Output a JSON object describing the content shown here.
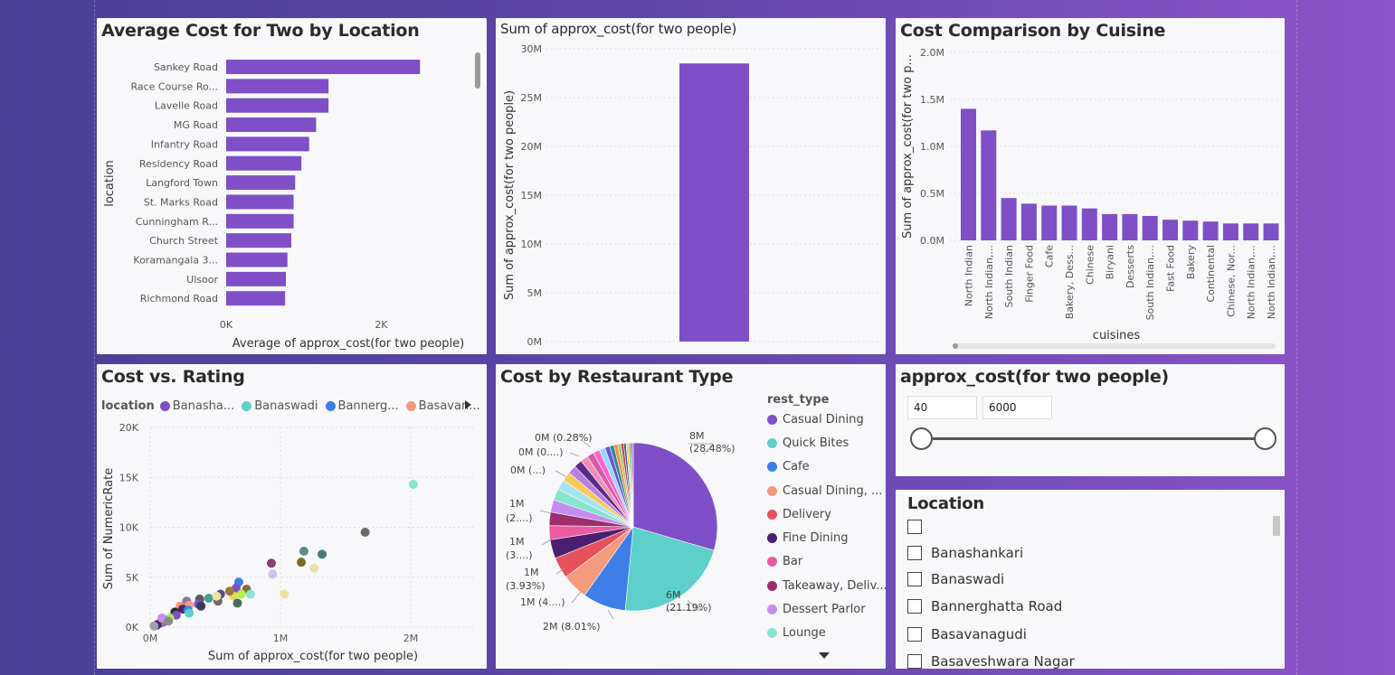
{
  "colors": {
    "bar": "#7e4fc6",
    "panel": "#f8f8fb"
  },
  "location_chart": {
    "title": "Average Cost for Two by Location",
    "xlabel": "Average of approx_cost(for two people)",
    "ylabel": "location",
    "x_ticks": [
      "0K",
      "2K"
    ]
  },
  "sum_chart": {
    "title": "Sum of approx_cost(for two people)",
    "ylabel": "Sum of approx_cost(for two people)",
    "y_ticks": [
      "0M",
      "5M",
      "10M",
      "15M",
      "20M",
      "25M",
      "30M"
    ]
  },
  "cuisine_chart": {
    "title": "Cost Comparison by Cuisine",
    "ylabel": "Sum of approx_cost(for two p...",
    "xlabel": "cuisines",
    "y_ticks": [
      "0.0M",
      "0.5M",
      "1.0M",
      "1.5M",
      "2.0M"
    ]
  },
  "scatter_chart": {
    "title": "Cost vs. Rating",
    "legend_title": "location",
    "legend": [
      {
        "name": "Banasha...",
        "color": "#7e4fc6"
      },
      {
        "name": "Banaswadi",
        "color": "#5ecfc9"
      },
      {
        "name": "Bannerg...",
        "color": "#3d7ee8"
      },
      {
        "name": "Basavan...",
        "color": "#f49a7f"
      }
    ],
    "xlabel": "Sum of approx_cost(for two people)",
    "ylabel": "Sum of NumericRate",
    "x_ticks": [
      "0M",
      "1M",
      "2M"
    ],
    "y_ticks": [
      "0K",
      "5K",
      "10K",
      "15K",
      "20K"
    ]
  },
  "pie_chart": {
    "title": "Cost by Restaurant Type",
    "legend_title": "rest_type",
    "legend": [
      {
        "name": "Casual Dining",
        "color": "#7e4fc6"
      },
      {
        "name": "Quick Bites",
        "color": "#5ecfc9"
      },
      {
        "name": "Cafe",
        "color": "#3d7ee8"
      },
      {
        "name": "Casual Dining, ...",
        "color": "#f49a7f"
      },
      {
        "name": "Delivery",
        "color": "#e8505b"
      },
      {
        "name": "Fine Dining",
        "color": "#4b1f6f"
      },
      {
        "name": "Bar",
        "color": "#ec5aa0"
      },
      {
        "name": "Takeaway, Deliv...",
        "color": "#9c2e6e"
      },
      {
        "name": "Dessert Parlor",
        "color": "#c58cf0"
      },
      {
        "name": "Lounge",
        "color": "#86e5cf"
      }
    ],
    "labels": {
      "l1a": "8M",
      "l1b": "(28.48%)",
      "l2a": "6M",
      "l2b": "(21.19%)",
      "l3": "2M (8.01%)",
      "l4": "1M (4....)",
      "l5a": "1M",
      "l5b": "(3.93%)",
      "l6a": "1M",
      "l6b": "(3....)",
      "l7a": "1M",
      "l7b": "(2....)",
      "l8": "0M (...)",
      "l9": "0M (0....)",
      "l10": "0M (0.28%)"
    }
  },
  "slider": {
    "title": "approx_cost(for two people)",
    "min": "40",
    "max": "6000"
  },
  "location_slicer": {
    "title": "Location",
    "items": [
      "",
      "Banashankari",
      "Banaswadi",
      "Bannerghatta Road",
      "Basavanagudi",
      "Basaveshwara Nagar"
    ]
  },
  "chart_data": [
    {
      "type": "bar",
      "title": "Average Cost for Two by Location",
      "categories": [
        "Sankey Road",
        "Race Course Ro...",
        "Lavelle Road",
        "MG Road",
        "Infantry Road",
        "Residency Road",
        "Langford Town",
        "St. Marks Road",
        "Cunningham R...",
        "Church Street",
        "Koramangala 3...",
        "Ulsoor",
        "Richmond Road"
      ],
      "values": [
        2500,
        1320,
        1320,
        1160,
        1070,
        970,
        890,
        870,
        870,
        840,
        790,
        770,
        760
      ],
      "xlabel": "Average of approx_cost(for two people)",
      "ylabel": "location",
      "xlim": [
        0,
        3150
      ]
    },
    {
      "type": "bar",
      "title": "Sum of approx_cost(for two people)",
      "categories": [
        ""
      ],
      "values": [
        28500000
      ],
      "ylim": [
        0,
        30000000
      ]
    },
    {
      "type": "bar",
      "title": "Cost Comparison by Cuisine",
      "categories": [
        "North Indian",
        "North Indian,...",
        "South Indian",
        "Finger Food",
        "Cafe",
        "Bakery, Dess...",
        "Chinese",
        "Biryani",
        "Desserts",
        "South Indian,...",
        "Fast Food",
        "Bakery",
        "Continental",
        "Chinese, Nor...",
        "North Indian,...",
        "North Indian,..."
      ],
      "values": [
        1400000,
        1170000,
        450000,
        390000,
        370000,
        370000,
        340000,
        280000,
        280000,
        260000,
        220000,
        210000,
        200000,
        180000,
        180000,
        180000
      ],
      "xlabel": "cuisines",
      "ylim": [
        0,
        2000000
      ]
    },
    {
      "type": "scatter",
      "title": "Cost vs. Rating",
      "points": [
        {
          "x": 2020000,
          "y": 14300,
          "color": "#86e5cf"
        },
        {
          "x": 1650000,
          "y": 9500,
          "color": "#6b6b6b"
        },
        {
          "x": 1320000,
          "y": 7300,
          "color": "#4b7a7a"
        },
        {
          "x": 1180000,
          "y": 7600,
          "color": "#5b8a8a"
        },
        {
          "x": 1160000,
          "y": 6500,
          "color": "#7a6a2a"
        },
        {
          "x": 1260000,
          "y": 5900,
          "color": "#e8e0b0"
        },
        {
          "x": 930000,
          "y": 6400,
          "color": "#8a3e6a"
        },
        {
          "x": 940000,
          "y": 5300,
          "color": "#c5c5f0"
        },
        {
          "x": 1030000,
          "y": 3300,
          "color": "#f0e0a0"
        },
        {
          "x": 680000,
          "y": 4500,
          "color": "#3d7ee8"
        },
        {
          "x": 660000,
          "y": 3900,
          "color": "#7e4fc6"
        },
        {
          "x": 740000,
          "y": 3800,
          "color": "#8a6a3a"
        },
        {
          "x": 770000,
          "y": 3300,
          "color": "#86e5cf"
        },
        {
          "x": 700000,
          "y": 3300,
          "color": "#b6f04a"
        },
        {
          "x": 640000,
          "y": 3100,
          "color": "#e8d95a"
        },
        {
          "x": 610000,
          "y": 3600,
          "color": "#9a7a3a"
        },
        {
          "x": 540000,
          "y": 3300,
          "color": "#5a4a8a"
        },
        {
          "x": 520000,
          "y": 2600,
          "color": "#6b6b6b"
        },
        {
          "x": 670000,
          "y": 2400,
          "color": "#4b6b5a"
        },
        {
          "x": 450000,
          "y": 2900,
          "color": "#4b9a9a"
        },
        {
          "x": 510000,
          "y": 3100,
          "color": "#f0e0a0"
        },
        {
          "x": 380000,
          "y": 2800,
          "color": "#5a5a5a"
        },
        {
          "x": 370000,
          "y": 2300,
          "color": "#7e4fc6"
        },
        {
          "x": 390000,
          "y": 2100,
          "color": "#3a3a5a"
        },
        {
          "x": 280000,
          "y": 2600,
          "color": "#8a7a9a"
        },
        {
          "x": 300000,
          "y": 2200,
          "color": "#f49a7f"
        },
        {
          "x": 230000,
          "y": 2100,
          "color": "#f49a7f"
        },
        {
          "x": 250000,
          "y": 1800,
          "color": "#4b1f6f"
        },
        {
          "x": 290000,
          "y": 1700,
          "color": "#3d7ee8"
        },
        {
          "x": 300000,
          "y": 1400,
          "color": "#5ecfc9"
        },
        {
          "x": 190000,
          "y": 1500,
          "color": "#2a2a2a"
        },
        {
          "x": 200000,
          "y": 1200,
          "color": "#7e4fc6"
        },
        {
          "x": 150000,
          "y": 900,
          "color": "#b6f04a"
        },
        {
          "x": 120000,
          "y": 700,
          "color": "#5ecfc9"
        },
        {
          "x": 100000,
          "y": 500,
          "color": "#7e4fc6"
        },
        {
          "x": 80000,
          "y": 400,
          "color": "#9a7a9a"
        },
        {
          "x": 60000,
          "y": 300,
          "color": "#6b6b6b"
        },
        {
          "x": 50000,
          "y": 200,
          "color": "#4b1f6f"
        },
        {
          "x": 30000,
          "y": 100,
          "color": "#a0a0a0"
        },
        {
          "x": 90000,
          "y": 900,
          "color": "#c58cf0"
        },
        {
          "x": 140000,
          "y": 600,
          "color": "#8a8a8a"
        }
      ],
      "xlabel": "Sum of approx_cost(for two people)",
      "ylabel": "Sum of NumericRate",
      "xlim": [
        0,
        2500000
      ],
      "ylim": [
        0,
        20000
      ]
    },
    {
      "type": "pie",
      "title": "Cost by Restaurant Type",
      "slices": [
        {
          "name": "Casual Dining",
          "value": 28.48,
          "color": "#7e4fc6"
        },
        {
          "name": "Quick Bites",
          "value": 21.19,
          "color": "#5ecfc9"
        },
        {
          "name": "Cafe",
          "value": 8.01,
          "color": "#3d7ee8"
        },
        {
          "name": "Casual Dining, ...",
          "value": 4.8,
          "color": "#f49a7f"
        },
        {
          "name": "Delivery",
          "value": 3.93,
          "color": "#e8505b"
        },
        {
          "name": "Fine Dining",
          "value": 3.5,
          "color": "#4b1f6f"
        },
        {
          "name": "Bar",
          "value": 2.6,
          "color": "#ec5aa0"
        },
        {
          "name": "Takeaway, Deliv...",
          "value": 2.5,
          "color": "#9c2e6e"
        },
        {
          "name": "Dessert Parlor",
          "value": 2.3,
          "color": "#c58cf0"
        },
        {
          "name": "Lounge",
          "value": 2.1,
          "color": "#86e5cf"
        },
        {
          "name": "",
          "value": 1.9,
          "color": "#a6e3f0"
        },
        {
          "name": "",
          "value": 1.7,
          "color": "#f7c85a"
        },
        {
          "name": "",
          "value": 1.6,
          "color": "#b97fe0"
        },
        {
          "name": "",
          "value": 1.5,
          "color": "#5a2c8a"
        },
        {
          "name": "",
          "value": 1.4,
          "color": "#ef8fb4"
        },
        {
          "name": "",
          "value": 1.3,
          "color": "#d65aa8"
        },
        {
          "name": "",
          "value": 1.2,
          "color": "#ff66cc"
        },
        {
          "name": "",
          "value": 1.1,
          "color": "#8fd9ff"
        },
        {
          "name": "",
          "value": 0.9,
          "color": "#6a4fd6"
        },
        {
          "name": "",
          "value": 0.8,
          "color": "#2f8a8a"
        },
        {
          "name": "",
          "value": 0.7,
          "color": "#f08a4a"
        },
        {
          "name": "",
          "value": 0.6,
          "color": "#99cc66"
        },
        {
          "name": "",
          "value": 0.5,
          "color": "#cc3366"
        },
        {
          "name": "",
          "value": 0.45,
          "color": "#336699"
        },
        {
          "name": "",
          "value": 0.4,
          "color": "#ffcc33"
        },
        {
          "name": "",
          "value": 0.35,
          "color": "#66cccc"
        },
        {
          "name": "",
          "value": 0.3,
          "color": "#996633"
        },
        {
          "name": "",
          "value": 0.28,
          "color": "#9966cc"
        }
      ]
    }
  ]
}
